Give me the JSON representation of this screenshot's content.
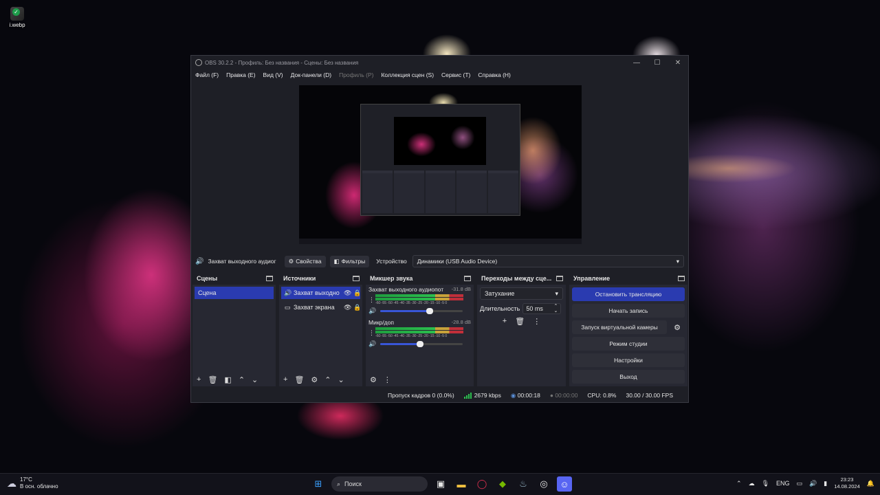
{
  "desktop": {
    "icon_label": "i.webp"
  },
  "window": {
    "title": "OBS 30.2.2 - Профиль: Без названия - Сцены: Без названия",
    "menu": [
      "Файл (F)",
      "Правка (E)",
      "Вид (V)",
      "Док-панели (D)",
      "Профиль (P)",
      "Коллекция сцен (S)",
      "Сервис (T)",
      "Справка (H)"
    ]
  },
  "props": {
    "source": "Захват выходного аудиог",
    "properties": "Свойства",
    "filters": "Фильтры",
    "device_label": "Устройство",
    "device_value": "Динамики (USB Audio Device)"
  },
  "scenes": {
    "title": "Сцены",
    "items": [
      "Сцена"
    ]
  },
  "sources": {
    "title": "Источники",
    "items": [
      "Захват выходно",
      "Захват экрана"
    ]
  },
  "mixer": {
    "title": "Микшер звука",
    "channels": [
      {
        "name": "Захват выходного аудиопот",
        "db": "-31.8 dB",
        "level": 0.6
      },
      {
        "name": "Микр/доп",
        "db": "-28.8 dB",
        "level": 0.48
      }
    ],
    "scale": "-60 -55 -50 -45 -40 -35 -30 -25 -20 -15 -10 -5 0"
  },
  "transitions": {
    "title": "Переходы между сце...",
    "type": "Затухание",
    "duration_label": "Длительность",
    "duration_value": "50 ms"
  },
  "controls": {
    "title": "Управление",
    "stop_stream": "Остановить трансляцию",
    "start_record": "Начать запись",
    "virtual_cam": "Запуск виртуальной камеры",
    "studio_mode": "Режим студии",
    "settings": "Настройки",
    "exit": "Выход"
  },
  "status": {
    "dropped": "Пропуск кадров 0 (0.0%)",
    "bitrate": "2679 kbps",
    "stream_time": "00:00:18",
    "rec_time": "00:00:00",
    "cpu": "CPU: 0.8%",
    "fps": "30.00 / 30.00 FPS"
  },
  "taskbar": {
    "temp": "17°C",
    "weather": "В осн. облачно",
    "search": "Поиск",
    "lang": "ENG",
    "time": "23:23",
    "date": "14.08.2024"
  },
  "colors": {
    "accent": "#2a3bb0",
    "panel": "#272832",
    "window": "#1e1f26"
  }
}
